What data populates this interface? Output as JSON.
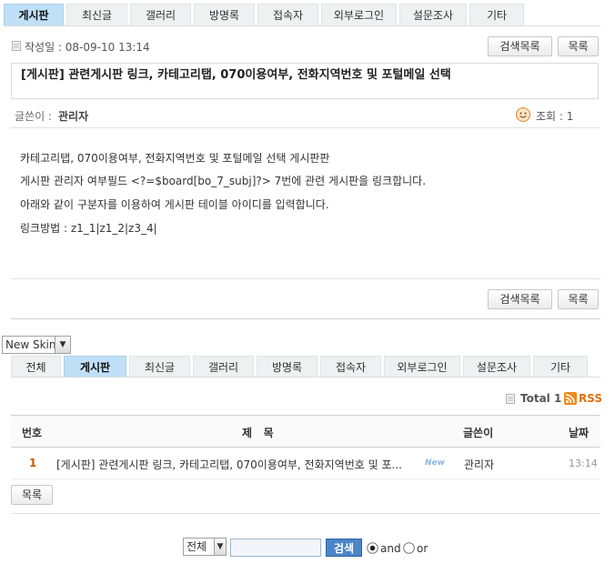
{
  "top_tabs": [
    "게시판",
    "최신글",
    "갤러리",
    "방명록",
    "접속자",
    "외부로그인",
    "설문조사",
    "기타"
  ],
  "post": {
    "date_label": "작성일 : 08-09-10 13:14",
    "search_list_btn": "검색목록",
    "list_btn": "목록",
    "title": "[게시판] 관련게시판 링크, 카테고리탭, 070이용여부, 전화지역번호 및 포털메일 선택",
    "author_label": "글쓴이 :",
    "author": "관리자",
    "views": "조회 : 1",
    "body": [
      "카테고리탭, 070이용여부, 전화지역번호 및 포털메일 선택 게시판판",
      "게시판 관리자 여부필드 <?=$board[bo_7_subj]?> 7번에 관련 게시판을 링크합니다.",
      "아래와 같이 구분자를 이용하여 게시판 테이블 아이디를 입력합니다.",
      "링크방법 : z1_1|z1_2|z3_4|"
    ]
  },
  "skin_select": "New Skin",
  "list_tabs": [
    "전체",
    "게시판",
    "최신글",
    "갤러리",
    "방명록",
    "접속자",
    "외부로그인",
    "설문조사",
    "기타"
  ],
  "total": "Total 1",
  "rss": "RSS",
  "columns": {
    "num": "번호",
    "subject": "제   목",
    "writer": "글쓴이",
    "date": "날짜"
  },
  "rows": [
    {
      "num": "1",
      "subject": "[게시판] 관련게시판 링크, 카테고리탭, 070이용여부, 전화지역번호 및 포...",
      "new_badge": "New",
      "writer": "관리자",
      "date": "13:14"
    }
  ],
  "bottom_list_btn": "목록",
  "search": {
    "field_select": "전체",
    "query_value": "",
    "search_btn": "검색",
    "op_and": "and",
    "op_or": "or",
    "selected_op": "and"
  }
}
